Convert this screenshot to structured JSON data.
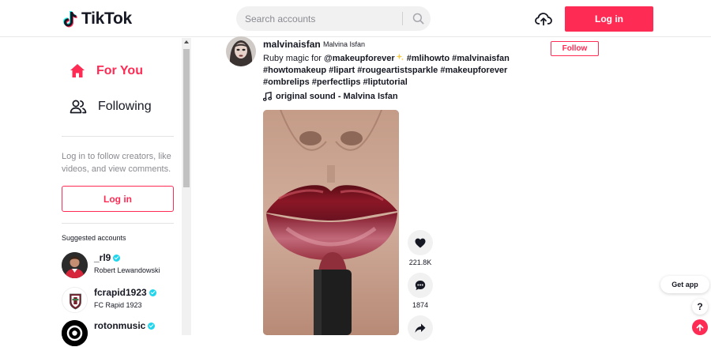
{
  "header": {
    "logo_text": "TikTok",
    "search": {
      "placeholder": "Search accounts",
      "value": ""
    },
    "upload_icon": "cloud-upload-icon",
    "login_label": "Log in"
  },
  "sidebar": {
    "nav": [
      {
        "label": "For You",
        "icon": "home-icon",
        "active": true
      },
      {
        "label": "Following",
        "icon": "people-icon",
        "active": false
      }
    ],
    "login_prompt": "Log in to follow creators, like videos, and view comments.",
    "login_label": "Log in",
    "suggested_title": "Suggested accounts",
    "accounts": [
      {
        "username": "_rl9",
        "nickname": "Robert Lewandowski",
        "verified": true
      },
      {
        "username": "fcrapid1923",
        "nickname": "FC Rapid 1923",
        "verified": true
      },
      {
        "username": "rotonmusic",
        "nickname": "",
        "verified": true
      }
    ]
  },
  "post": {
    "username": "malvinaisfan",
    "nickname": "Malvina Isfan",
    "follow_label": "Follow",
    "caption_text": "Ruby magic for ",
    "caption_mention": "@makeupforever",
    "caption_hashtags_1": " #mlihowto #malvinaisfan",
    "caption_hashtags_2": "#howtomakeup #lipart #rougeartistsparkle #makeupforever",
    "caption_hashtags_3": "#ombrelips #perfectlips #liptutorial",
    "sound": "original sound - Malvina Isfan",
    "likes": "221.8K",
    "comments": "1874"
  },
  "floating": {
    "get_app": "Get app",
    "help": "?"
  },
  "colors": {
    "accent": "#fe2c55",
    "text": "#161823",
    "muted": "#8a8b91",
    "verified": "#20d5ec"
  }
}
